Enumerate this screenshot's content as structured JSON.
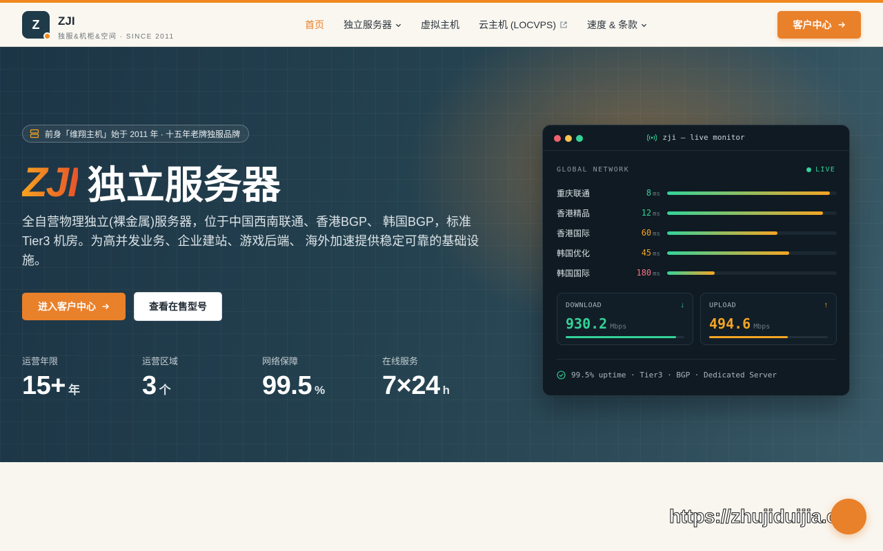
{
  "brand": {
    "logo_letter": "Z",
    "name": "ZJI",
    "tagline": "独服&机柜&空间 · SINCE 2011"
  },
  "nav": {
    "items": [
      {
        "label": "首页",
        "active": true
      },
      {
        "label": "独立服务器",
        "dropdown": true
      },
      {
        "label": "虚拟主机"
      },
      {
        "label": "云主机 (LOCVPS)",
        "external": true
      },
      {
        "label": "速度 & 条款",
        "dropdown": true
      }
    ],
    "cta": "客户中心"
  },
  "hero": {
    "badge": "前身「维翔主机」始于 2011 年 · 十五年老牌独服品牌",
    "title_brand": "ZJI",
    "title": "独立服务器",
    "description": "全自营物理独立(裸金属)服务器，位于中国西南联通、香港BGP、 韩国BGP，标准 Tier3 机房。为高并发业务、企业建站、游戏后端、 海外加速提供稳定可靠的基础设施。",
    "primary_button": "进入客户中心",
    "secondary_button": "查看在售型号",
    "stats": [
      {
        "label": "运营年限",
        "value": "15+",
        "unit": "年"
      },
      {
        "label": "运营区域",
        "value": "3",
        "unit": "个"
      },
      {
        "label": "网络保障",
        "value": "99.5",
        "unit": "%"
      },
      {
        "label": "在线服务",
        "value": "7×24",
        "unit": "h"
      }
    ]
  },
  "monitor": {
    "title": "zji — live monitor",
    "section": "GLOBAL NETWORK",
    "live": "LIVE",
    "unit_ms": "ms",
    "rows": [
      {
        "name": "重庆联通",
        "ms": "8",
        "level": 0.96,
        "color": "#34d399"
      },
      {
        "name": "香港精品",
        "ms": "12",
        "level": 0.92,
        "color": "#34d399"
      },
      {
        "name": "香港国际",
        "ms": "60",
        "level": 0.65,
        "color": "#f5a524"
      },
      {
        "name": "韩国优化",
        "ms": "45",
        "level": 0.72,
        "color": "#f5a524"
      },
      {
        "name": "韩国国际",
        "ms": "180",
        "level": 0.28,
        "color": "#fb7185"
      }
    ],
    "download": {
      "label": "DOWNLOAD",
      "value": "930.2",
      "unit": "Mbps",
      "level": 0.93,
      "color": "#34d399"
    },
    "upload": {
      "label": "UPLOAD",
      "value": "494.6",
      "unit": "Mbps",
      "level": 0.66,
      "color": "#f5a524"
    },
    "footer": "99.5% uptime · Tier3 · BGP · Dedicated Server"
  },
  "watermark": "https://zhujiduijia.com",
  "colors": {
    "accent": "#e9802a",
    "hero_dark": "#1c3546",
    "good": "#34d399",
    "warn": "#f5a524",
    "bad": "#fb7185"
  }
}
